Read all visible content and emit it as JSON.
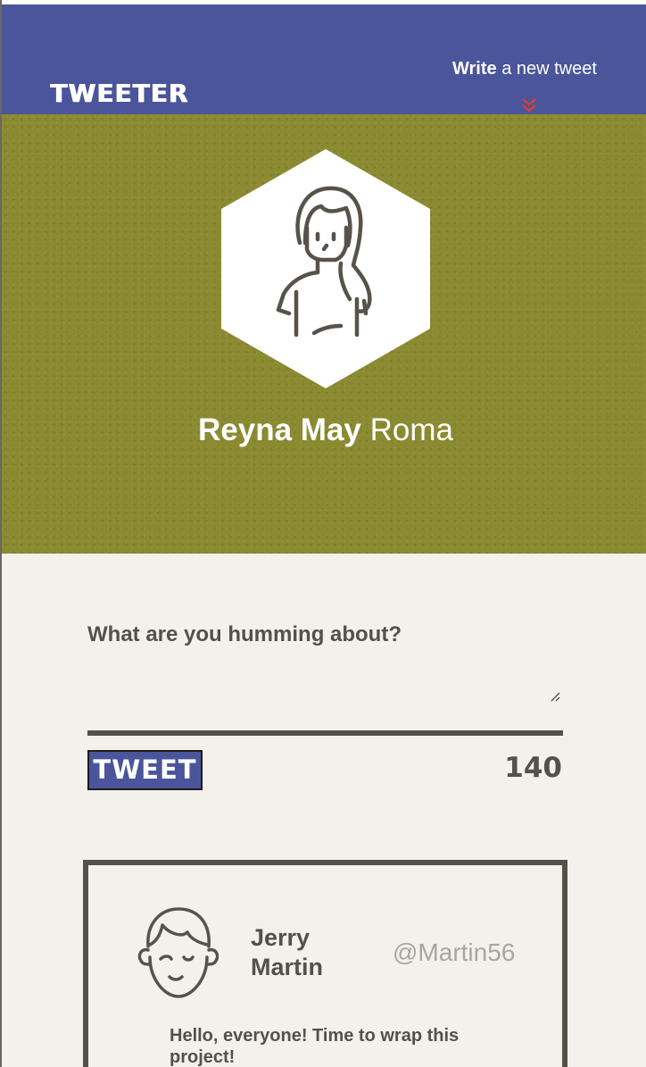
{
  "nav": {
    "brand": "TWEETER",
    "compose_link": {
      "bold": "Write",
      "rest": " a new tweet"
    },
    "compose_icon": "double-chevron-down-icon"
  },
  "profile": {
    "avatar_icon": "woman-avatar-icon",
    "first_name": "Reyna May",
    "last_name": " Roma"
  },
  "compose": {
    "label": "What are you humming about?",
    "input_value": "",
    "button_label": "TWEET",
    "char_counter": "140"
  },
  "tweets": [
    {
      "avatar_icon": "man-winking-avatar-icon",
      "name": "Jerry Martin",
      "handle": "@Martin56",
      "text": "Hello, everyone! Time to wrap this project!"
    }
  ],
  "colors": {
    "nav_bg": "#4a559b",
    "header_bg": "#8b8a32",
    "page_bg": "#f4f1ec",
    "text_dark": "#545149",
    "handle_grey": "#a9a69e",
    "accent_red": "#d23f3f"
  }
}
